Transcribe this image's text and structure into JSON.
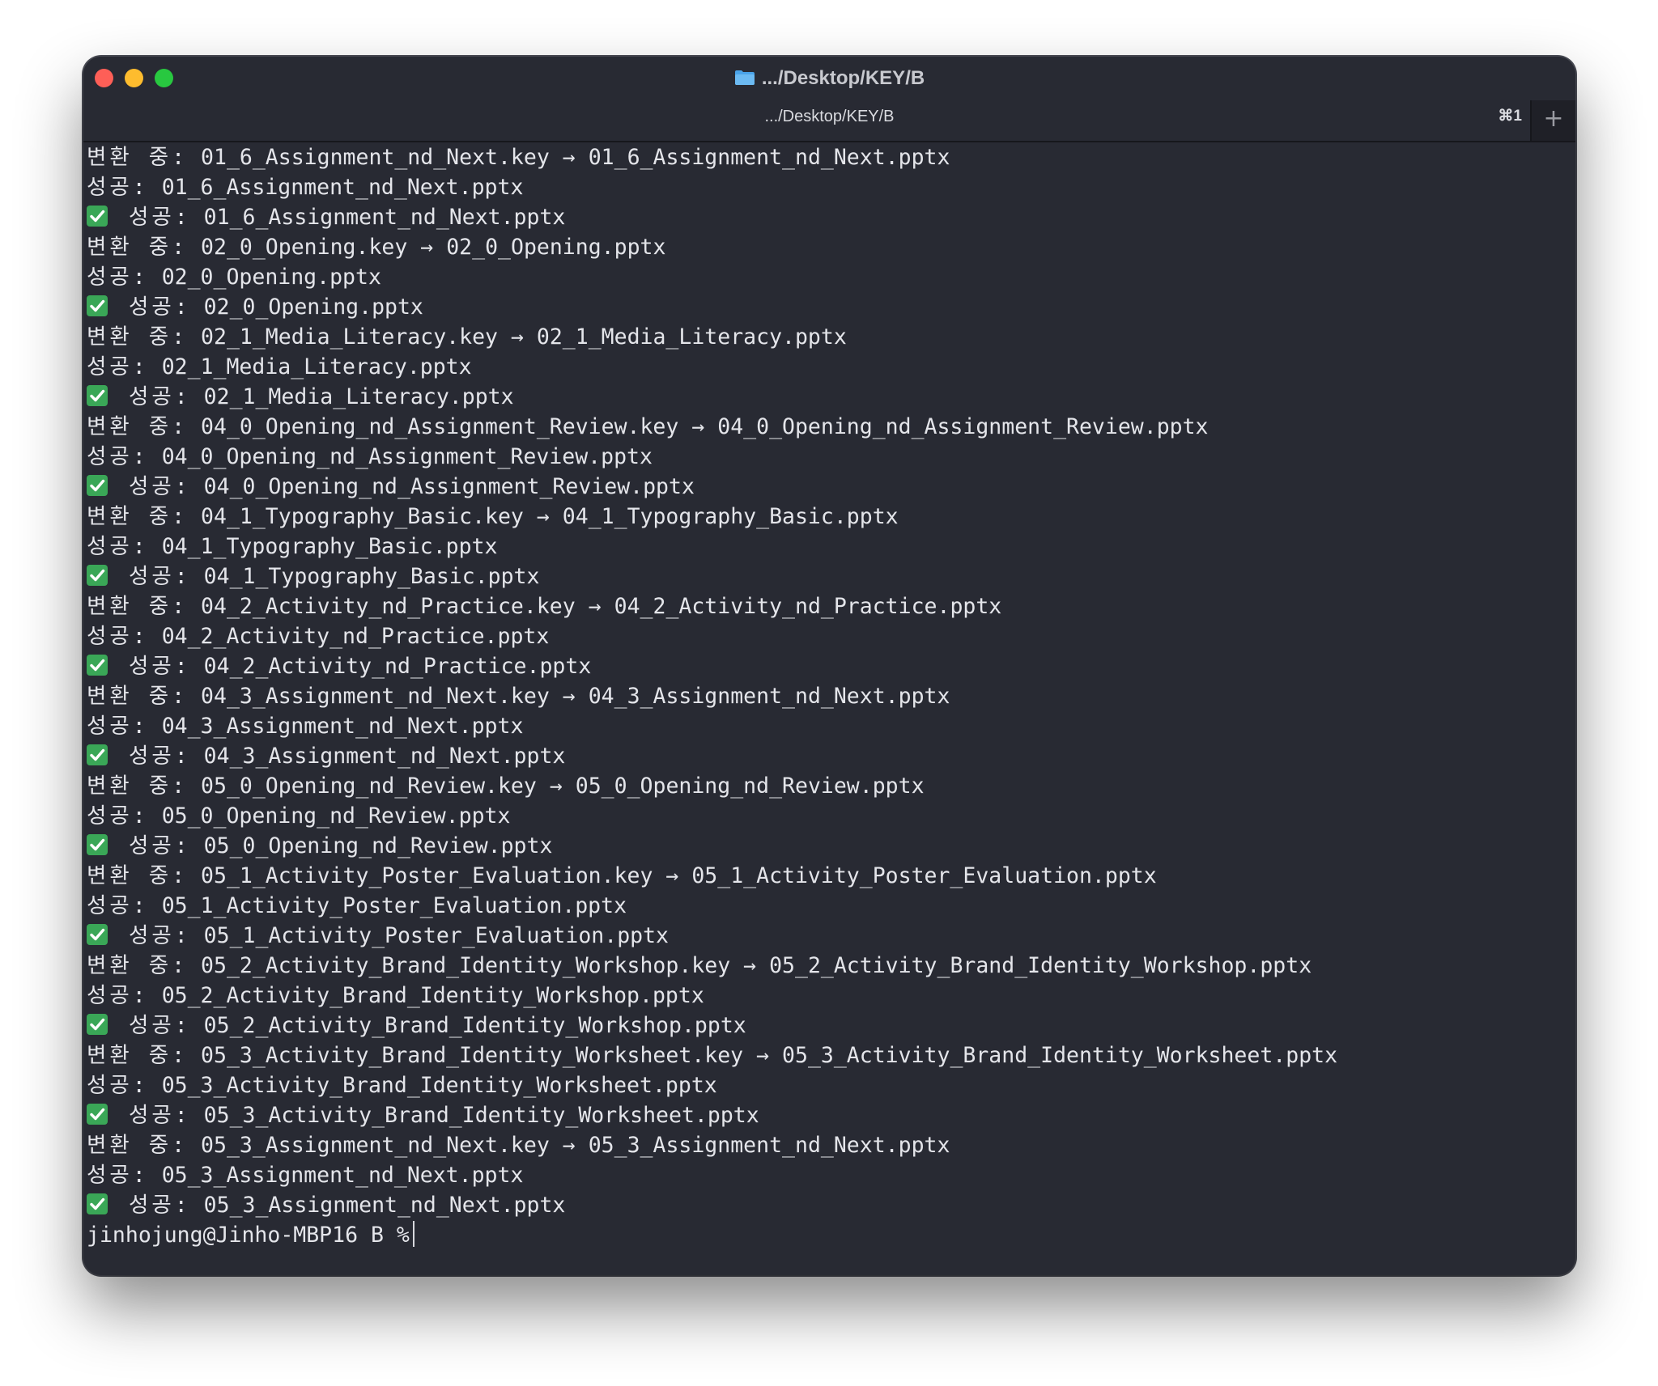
{
  "window": {
    "title": ".../Desktop/KEY/B",
    "folder_icon": "folder-icon"
  },
  "tab": {
    "title": ".../Desktop/KEY/B",
    "shortcut": "⌘1",
    "add_label": "+"
  },
  "labels": {
    "converting": "변환 중:",
    "success": "성공:",
    "arrow": "→"
  },
  "lines": [
    {
      "kind": "convert",
      "src": "01_6_Assignment_nd_Next.key",
      "dst": "01_6_Assignment_nd_Next.pptx"
    },
    {
      "kind": "success",
      "file": "01_6_Assignment_nd_Next.pptx"
    },
    {
      "kind": "check",
      "file": "01_6_Assignment_nd_Next.pptx"
    },
    {
      "kind": "convert",
      "src": "02_0_Opening.key",
      "dst": "02_0_Opening.pptx"
    },
    {
      "kind": "success",
      "file": "02_0_Opening.pptx"
    },
    {
      "kind": "check",
      "file": "02_0_Opening.pptx"
    },
    {
      "kind": "convert",
      "src": "02_1_Media_Literacy.key",
      "dst": "02_1_Media_Literacy.pptx"
    },
    {
      "kind": "success",
      "file": "02_1_Media_Literacy.pptx"
    },
    {
      "kind": "check",
      "file": "02_1_Media_Literacy.pptx"
    },
    {
      "kind": "convert",
      "src": "04_0_Opening_nd_Assignment_Review.key",
      "dst": "04_0_Opening_nd_Assignment_Review.pptx"
    },
    {
      "kind": "success",
      "file": "04_0_Opening_nd_Assignment_Review.pptx"
    },
    {
      "kind": "check",
      "file": "04_0_Opening_nd_Assignment_Review.pptx"
    },
    {
      "kind": "convert",
      "src": "04_1_Typography_Basic.key",
      "dst": "04_1_Typography_Basic.pptx"
    },
    {
      "kind": "success",
      "file": "04_1_Typography_Basic.pptx"
    },
    {
      "kind": "check",
      "file": "04_1_Typography_Basic.pptx"
    },
    {
      "kind": "convert",
      "src": "04_2_Activity_nd_Practice.key",
      "dst": "04_2_Activity_nd_Practice.pptx"
    },
    {
      "kind": "success",
      "file": "04_2_Activity_nd_Practice.pptx"
    },
    {
      "kind": "check",
      "file": "04_2_Activity_nd_Practice.pptx"
    },
    {
      "kind": "convert",
      "src": "04_3_Assignment_nd_Next.key",
      "dst": "04_3_Assignment_nd_Next.pptx"
    },
    {
      "kind": "success",
      "file": "04_3_Assignment_nd_Next.pptx"
    },
    {
      "kind": "check",
      "file": "04_3_Assignment_nd_Next.pptx"
    },
    {
      "kind": "convert",
      "src": "05_0_Opening_nd_Review.key",
      "dst": "05_0_Opening_nd_Review.pptx"
    },
    {
      "kind": "success",
      "file": "05_0_Opening_nd_Review.pptx"
    },
    {
      "kind": "check",
      "file": "05_0_Opening_nd_Review.pptx"
    },
    {
      "kind": "convert",
      "src": "05_1_Activity_Poster_Evaluation.key",
      "dst": "05_1_Activity_Poster_Evaluation.pptx"
    },
    {
      "kind": "success",
      "file": "05_1_Activity_Poster_Evaluation.pptx"
    },
    {
      "kind": "check",
      "file": "05_1_Activity_Poster_Evaluation.pptx"
    },
    {
      "kind": "convert",
      "src": "05_2_Activity_Brand_Identity_Workshop.key",
      "dst": "05_2_Activity_Brand_Identity_Workshop.pptx"
    },
    {
      "kind": "success",
      "file": "05_2_Activity_Brand_Identity_Workshop.pptx"
    },
    {
      "kind": "check",
      "file": "05_2_Activity_Brand_Identity_Workshop.pptx"
    },
    {
      "kind": "convert",
      "src": "05_3_Activity_Brand_Identity_Worksheet.key",
      "dst": "05_3_Activity_Brand_Identity_Worksheet.pptx"
    },
    {
      "kind": "success",
      "file": "05_3_Activity_Brand_Identity_Worksheet.pptx"
    },
    {
      "kind": "check",
      "file": "05_3_Activity_Brand_Identity_Worksheet.pptx"
    },
    {
      "kind": "convert",
      "src": "05_3_Assignment_nd_Next.key",
      "dst": "05_3_Assignment_nd_Next.pptx"
    },
    {
      "kind": "success",
      "file": "05_3_Assignment_nd_Next.pptx"
    },
    {
      "kind": "check",
      "file": "05_3_Assignment_nd_Next.pptx"
    }
  ],
  "prompt": "jinhojung@Jinho-MBP16 B %",
  "colors": {
    "background": "#282a33",
    "text": "#e4e5ea",
    "check": "#3aa757",
    "close": "#fe5f57",
    "minimize": "#febc2e",
    "zoom": "#28c840"
  }
}
